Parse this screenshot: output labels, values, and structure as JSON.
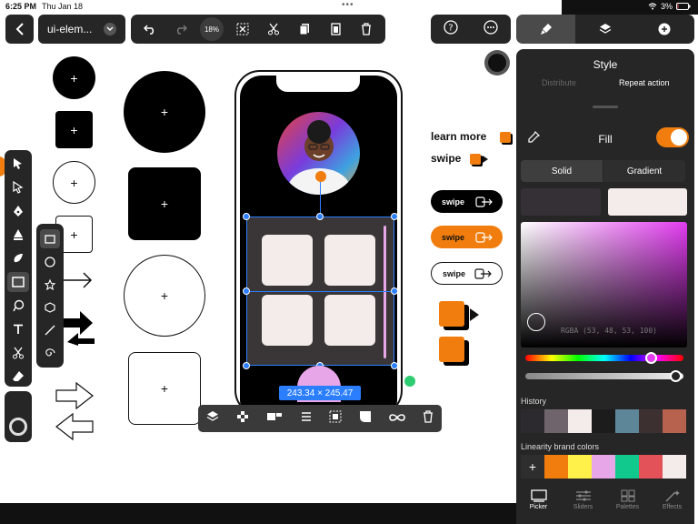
{
  "status": {
    "time": "6:25 PM",
    "date": "Thu Jan 18",
    "battery": "3%"
  },
  "header": {
    "doc_title": "ui-elem...",
    "zoom": "18%"
  },
  "panel": {
    "title": "Style",
    "subtabs": [
      "Distribute",
      "Repeat action"
    ],
    "fill_label": "Fill",
    "segments": [
      "Solid",
      "Gradient"
    ],
    "rgba_readout": "RGBA (53, 48, 53, 100)",
    "history_label": "History",
    "brand_label": "Linearity brand colors",
    "history_colors": [
      "#2c2a2e",
      "#6f646b",
      "#f4ecea",
      "#1c1c1c",
      "#5e8699",
      "#3c3031",
      "#b6624f"
    ],
    "brand_colors": [
      "#f07d0d",
      "#fff04a",
      "#e7a6e8",
      "#11c98d",
      "#e35259",
      "#f4ecea"
    ]
  },
  "bottom_nav": [
    "Picker",
    "Sliders",
    "Palettes",
    "Effects"
  ],
  "canvas": {
    "learn_more": "learn more",
    "swipe": "swipe",
    "pills": [
      "swipe",
      "swipe",
      "swipe"
    ],
    "dimension": "243.34 × 245.47"
  },
  "colors": {
    "accent": "#f07d0d",
    "selection": "#2b7fff",
    "panel": "#262626"
  }
}
